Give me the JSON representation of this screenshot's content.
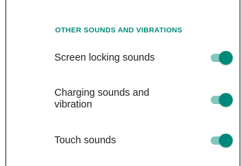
{
  "section": {
    "header": "OTHER SOUNDS AND VIBRATIONS"
  },
  "settings": [
    {
      "label": "Screen locking sounds",
      "enabled": true
    },
    {
      "label": "Charging sounds and vibration",
      "enabled": true
    },
    {
      "label": "Touch sounds",
      "enabled": true
    }
  ],
  "colors": {
    "accent": "#00897b",
    "track_on": "#7fc8bd",
    "text_primary": "#212121"
  }
}
